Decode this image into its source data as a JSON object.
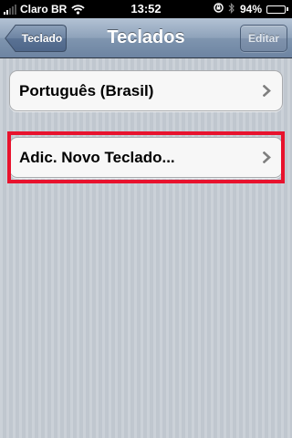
{
  "status_bar": {
    "carrier": "Claro BR",
    "time": "13:52",
    "battery_percent": "94%",
    "battery_level": 0.94,
    "signal_bars_filled": 2,
    "signal_bars_total": 5,
    "icons": [
      "signal-icon",
      "wifi-icon",
      "lock-rotation-icon",
      "bluetooth-icon",
      "battery-icon"
    ]
  },
  "nav_bar": {
    "back_label": "Teclado",
    "title": "Teclados",
    "edit_label": "Editar"
  },
  "keyboards": [
    {
      "label": "Português (Brasil)",
      "icon": "chevron-right-icon"
    }
  ],
  "add_keyboard": {
    "label": "Adic. Novo Teclado...",
    "icon": "chevron-right-icon"
  },
  "colors": {
    "nav_bar": "#7f95af",
    "background": "#c5ccd4",
    "highlight": "#e8122d",
    "chevron": "#7f7f7f"
  }
}
